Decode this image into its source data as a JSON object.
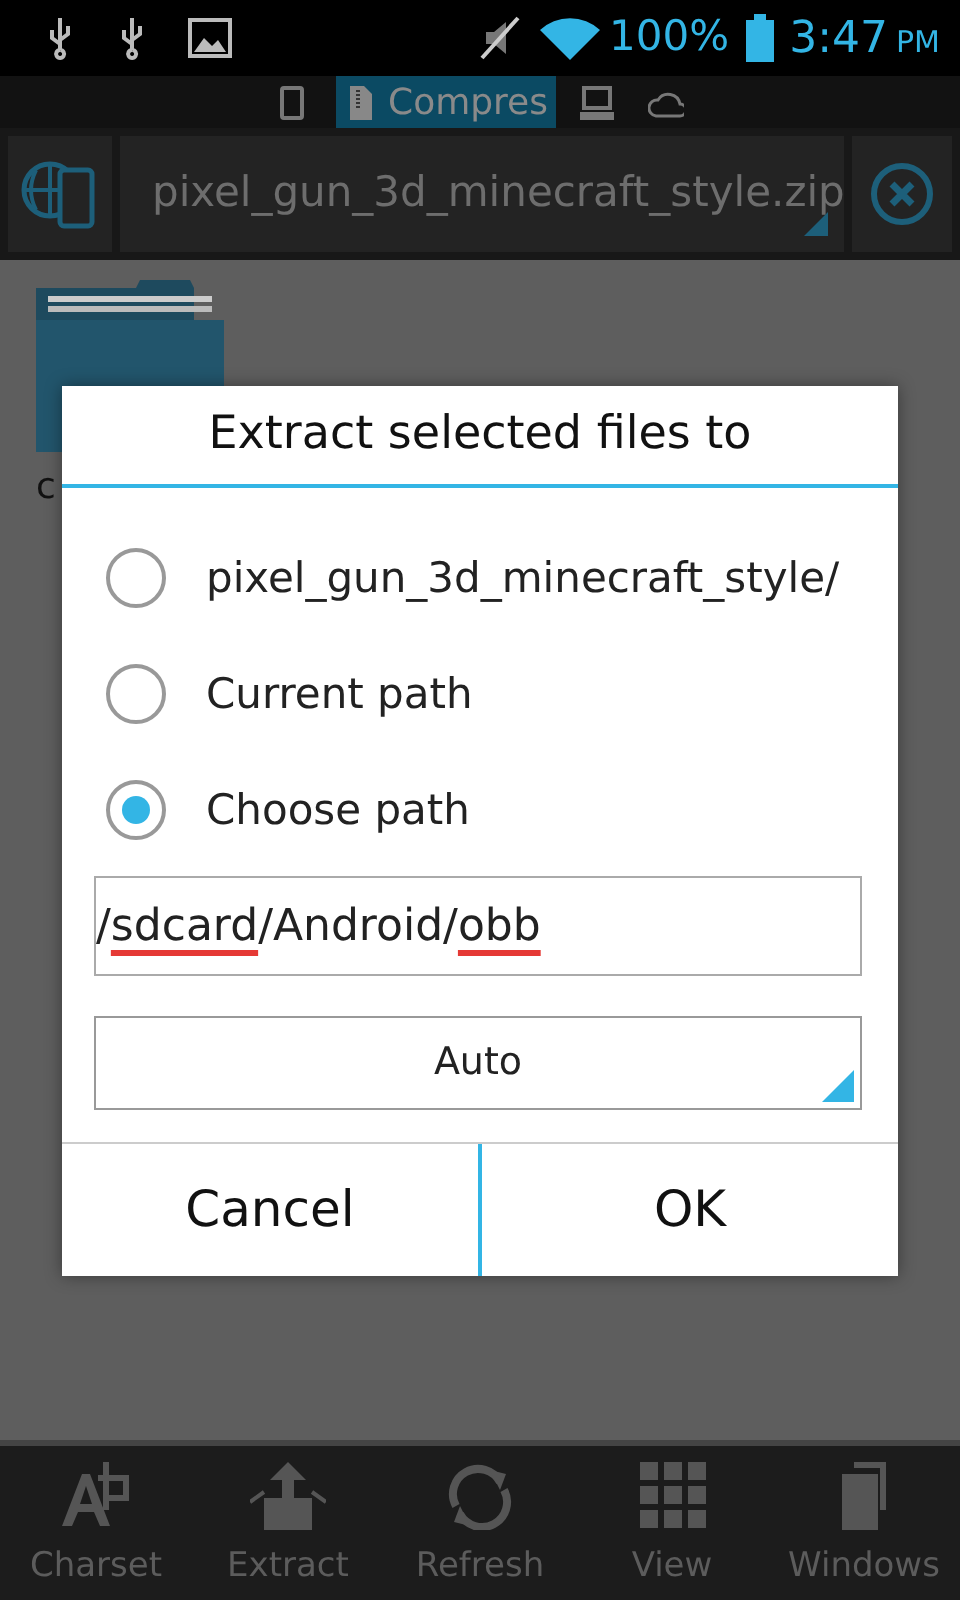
{
  "status_bar": {
    "battery": "100%",
    "time": "3:47",
    "ampm": "PM"
  },
  "tabs": [
    {
      "selected": false
    },
    {
      "label": "Compres",
      "selected": true
    },
    {
      "selected": false
    },
    {
      "selected": false
    }
  ],
  "path_bar": {
    "file": "pixel_gun_3d_minecraft_style.zip"
  },
  "files": [
    {
      "label": "c"
    }
  ],
  "dialog": {
    "title": "Extract selected files to",
    "options": [
      {
        "label": "pixel_gun_3d_minecraft_style/",
        "selected": false
      },
      {
        "label": "Current path",
        "selected": false
      },
      {
        "label": "Choose path",
        "selected": true
      }
    ],
    "path_field": [
      {
        "text": "/",
        "misspelled": false
      },
      {
        "text": "sdcard",
        "misspelled": true
      },
      {
        "text": "/Android/",
        "misspelled": false
      },
      {
        "text": "obb",
        "misspelled": true
      }
    ],
    "charset": "Auto",
    "buttons": [
      "Cancel",
      "OK"
    ]
  },
  "bottom_bar": [
    {
      "label": "Charset"
    },
    {
      "label": "Extract"
    },
    {
      "label": "Refresh"
    },
    {
      "label": "View"
    },
    {
      "label": "Windows"
    }
  ]
}
